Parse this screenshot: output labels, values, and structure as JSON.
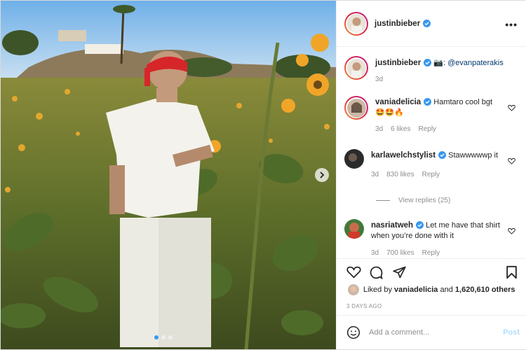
{
  "post": {
    "author": "justinbieber",
    "caption_icon": "camera-emoji",
    "caption_mention": "@evanpaterakis",
    "caption_prefix": "📷:",
    "caption_age": "3d",
    "more_label": "•••"
  },
  "comments": [
    {
      "user": "vaniadelicia",
      "verified": true,
      "text": "Hamtaro cool bgt",
      "emoji": "🤩🤩🔥",
      "age": "3d",
      "likes": "6 likes",
      "reply": "Reply"
    },
    {
      "user": "karlawelchstylist",
      "verified": true,
      "text": "Stawwwwwp it",
      "age": "3d",
      "likes": "830 likes",
      "reply": "Reply",
      "view_replies": "View replies (25)"
    },
    {
      "user": "nasriatweh",
      "verified": true,
      "text": "Let me have that shirt when you’re done with it",
      "age": "3d",
      "likes": "700 likes",
      "reply": "Reply"
    }
  ],
  "likes": {
    "prefix": "Liked by",
    "user": "vaniadelicia",
    "middle": "and",
    "count": "1,620,610 others"
  },
  "posted": "3 DAYS AGO",
  "composer": {
    "placeholder": "Add a comment...",
    "post_label": "Post"
  },
  "carousel": {
    "current": 1,
    "total": 3
  },
  "colors": {
    "verified": "#3897f0",
    "link": "#00376b",
    "muted": "#8e8e8e",
    "post_disabled": "#b2dffc"
  }
}
